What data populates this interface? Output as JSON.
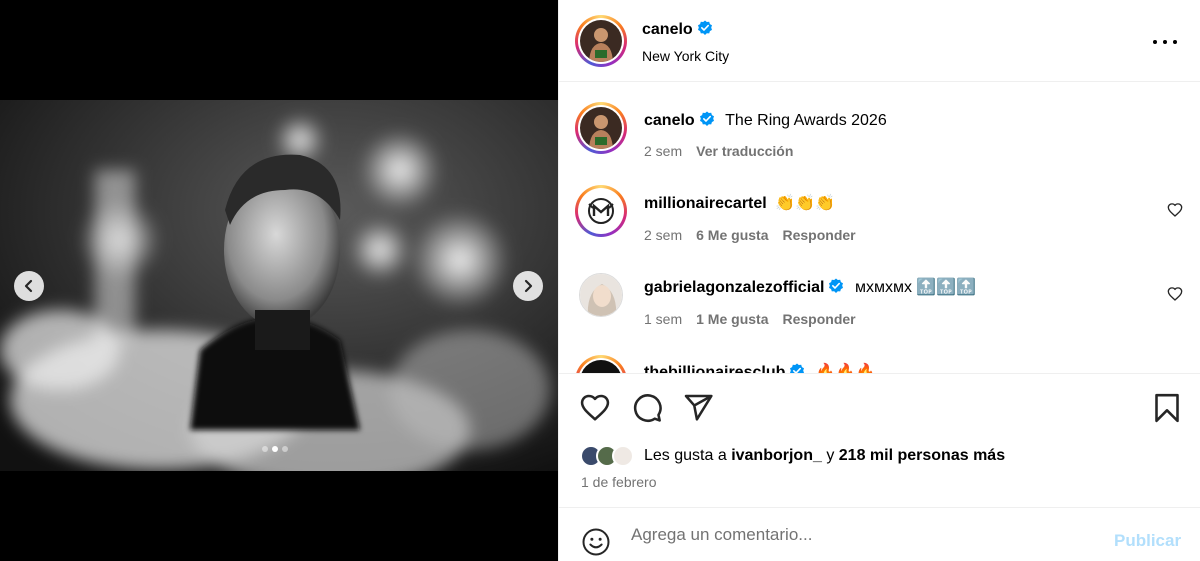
{
  "post": {
    "author": "canelo",
    "location": "New York City",
    "more_icon": "more-horizontal-icon",
    "media": {
      "slide_count": 3,
      "active_slide": 2,
      "prev_icon": "chevron-left-icon",
      "next_icon": "chevron-right-icon"
    }
  },
  "caption": {
    "username": "canelo",
    "text": "The Ring Awards 2026",
    "time": "2 sem",
    "translate": "Ver traducción"
  },
  "comments": [
    {
      "username": "millionairecartel",
      "text": "👏👏👏",
      "time": "2 sem",
      "likes": "6 Me gusta",
      "reply": "Responder",
      "verified": false
    },
    {
      "username": "gabrielagonzalezofficial",
      "text": "ᴍxᴍxᴍx 🔝🔝🔝",
      "time": "1 sem",
      "likes": "1 Me gusta",
      "reply": "Responder",
      "verified": true
    },
    {
      "username": "thebillionairesclub",
      "text": "🔥🔥🔥",
      "verified": true
    }
  ],
  "actions": {
    "like_icon": "heart-icon",
    "comment_icon": "comment-icon",
    "share_icon": "send-icon",
    "save_icon": "bookmark-icon"
  },
  "likes": {
    "prefix": "Les gusta a",
    "user": "ivanborjon_",
    "connector": "y",
    "others": "218 mil personas más"
  },
  "date": "1 de febrero",
  "composer": {
    "emoji_icon": "smiley-icon",
    "placeholder": "Agrega un comentario...",
    "publish_label": "Publicar"
  },
  "colors": {
    "verified": "#0095f6",
    "muted": "#737373",
    "publish_disabled": "#b2dffc"
  }
}
